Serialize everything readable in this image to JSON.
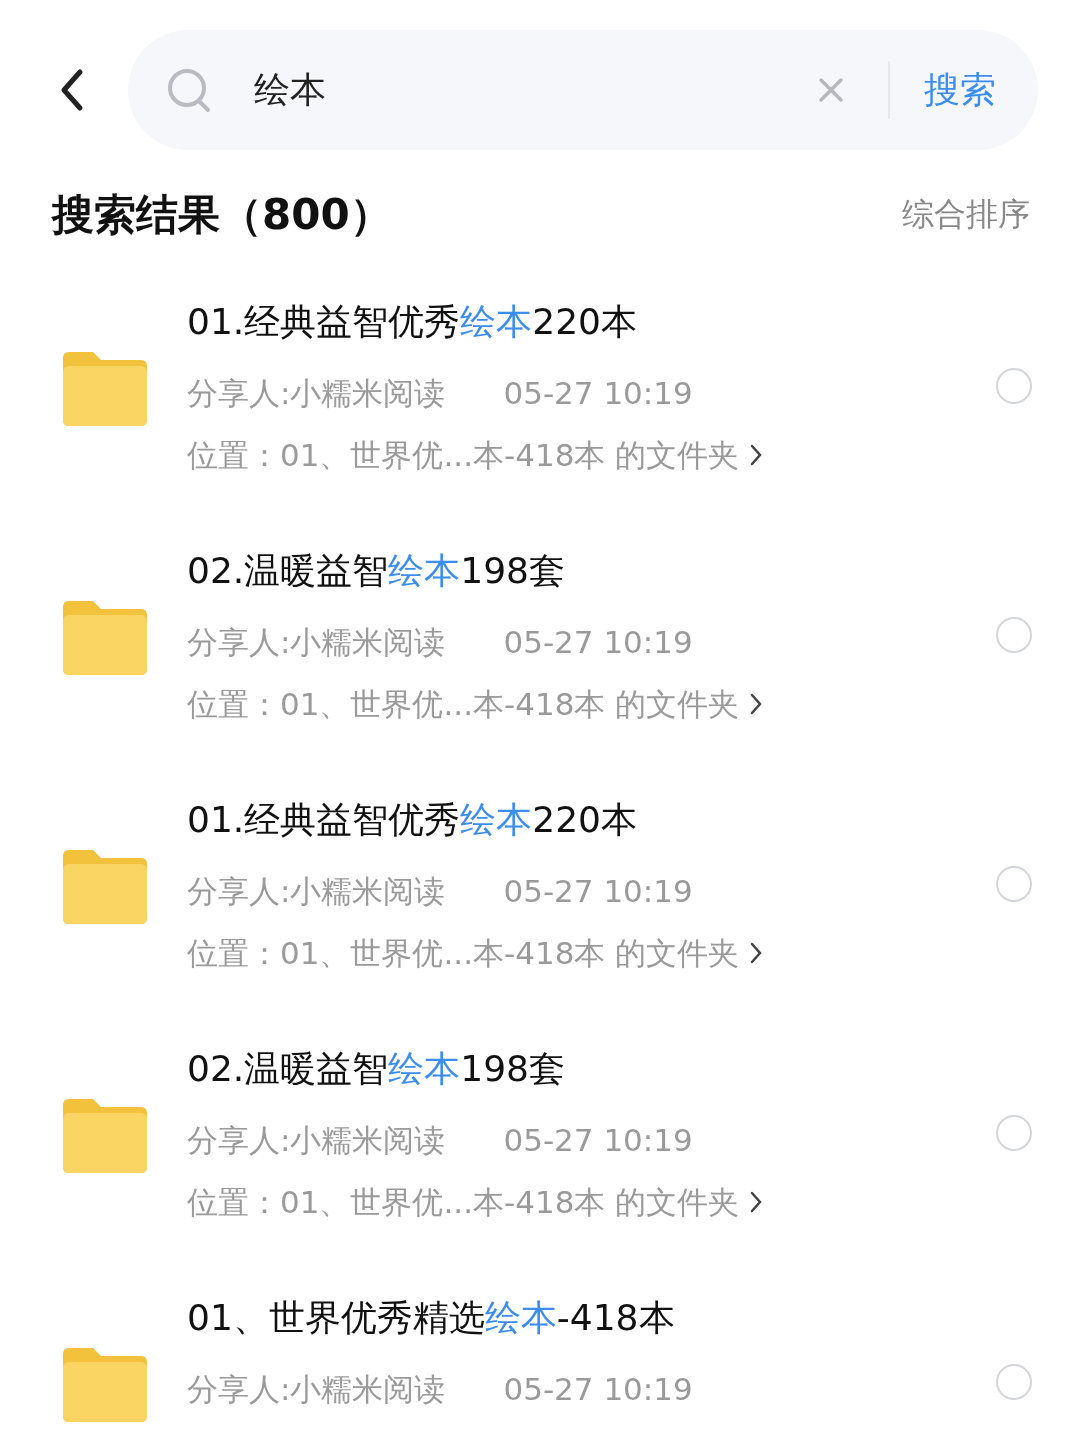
{
  "search": {
    "value": "绘本",
    "button": "搜索"
  },
  "results_header": {
    "title": "搜索结果（800）",
    "sort": "综合排序"
  },
  "results": [
    {
      "title_before": "01.经典益智优秀",
      "title_match": "绘本",
      "title_after": "220本",
      "sharer": "分享人:小糯米阅读",
      "time": "05-27 10:19",
      "location": "位置：01、世界优...本-418本 的文件夹",
      "selected": false
    },
    {
      "title_before": "02.温暖益智",
      "title_match": "绘本",
      "title_after": "198套",
      "sharer": "分享人:小糯米阅读",
      "time": "05-27 10:19",
      "location": "位置：01、世界优...本-418本 的文件夹",
      "selected": false
    },
    {
      "title_before": "01.经典益智优秀",
      "title_match": "绘本",
      "title_after": "220本",
      "sharer": "分享人:小糯米阅读",
      "time": "05-27 10:19",
      "location": "位置：01、世界优...本-418本 的文件夹",
      "selected": false
    },
    {
      "title_before": "02.温暖益智",
      "title_match": "绘本",
      "title_after": "198套",
      "sharer": "分享人:小糯米阅读",
      "time": "05-27 10:19",
      "location": "位置：01、世界优...本-418本 的文件夹",
      "selected": false
    },
    {
      "title_before": "01、世界优秀精选",
      "title_match": "绘本",
      "title_after": "-418本",
      "sharer": "分享人:小糯米阅读",
      "time": "05-27 10:19",
      "selected": false
    }
  ]
}
